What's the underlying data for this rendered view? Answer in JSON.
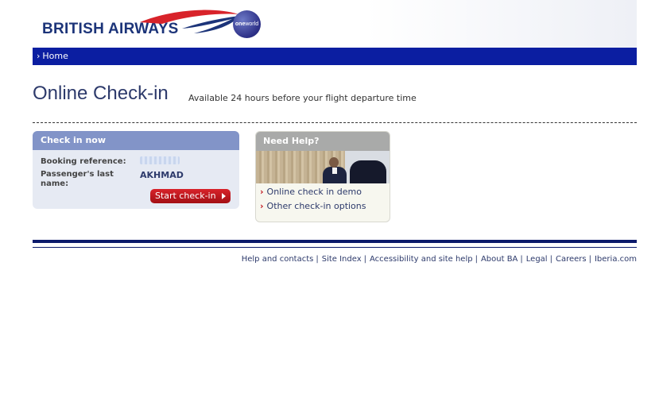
{
  "header": {
    "brand": "BRITISH AIRWAYS",
    "alliance_logo": {
      "bold": "one",
      "light": "world"
    },
    "colors": {
      "brand_blue": "#1c3479",
      "brand_red": "#d8232a"
    }
  },
  "nav": {
    "home_label": "Home",
    "home_icon": "chevron-right-icon"
  },
  "main": {
    "title": "Online Check-in",
    "subtitle": "Available 24 hours before your flight departure time"
  },
  "checkin": {
    "heading": "Check in now",
    "booking_label": "Booking reference:",
    "passenger_label": "Passenger's last name:",
    "passenger_value": "AKHMAD",
    "start_button": "Start check-in"
  },
  "help": {
    "heading": "Need Help?",
    "links": [
      "Online check in demo",
      "Other check-in options"
    ]
  },
  "footer": {
    "links": [
      "Help and contacts",
      "Site Index",
      "Accessibility and site help",
      "About BA",
      "Legal",
      "Careers",
      "Iberia.com"
    ]
  }
}
